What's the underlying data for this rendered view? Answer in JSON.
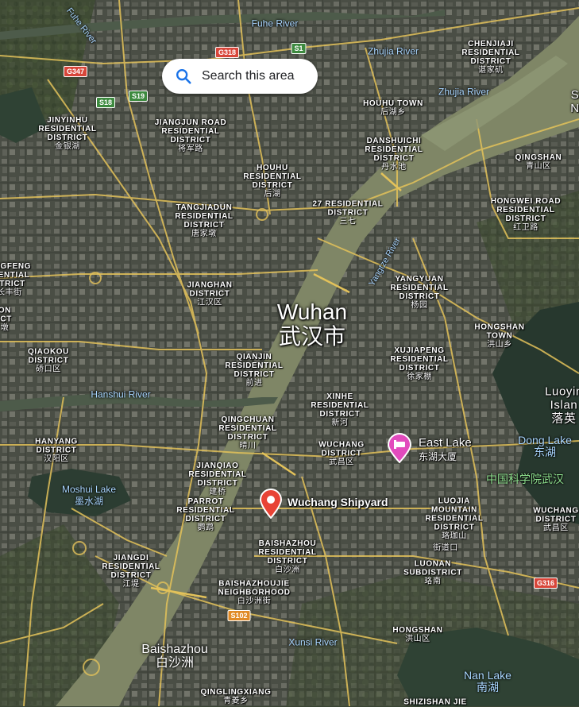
{
  "search": {
    "label": "Search this area",
    "icon": "search-icon"
  },
  "city": {
    "name_en": "Wuhan",
    "name_zh": "武汉市"
  },
  "colors": {
    "river": "#7f8666",
    "road": "#e3c25a",
    "search_icon": "#1a73e8",
    "marker_red": "#e84335",
    "marker_pink": "#e24bbd"
  },
  "markers": [
    {
      "id": "wuchang-shipyard",
      "label": "Wuchang Shipyard",
      "icon": "red-pin-icon"
    },
    {
      "id": "east-lake",
      "label": "East Lake",
      "label_zh": "东湖大厦",
      "icon": "hotel-pin-icon"
    }
  ],
  "shields": [
    "G347",
    "G318",
    "S1",
    "S18",
    "S19",
    "G316",
    "S102"
  ],
  "water": [
    {
      "id": "fuhe-river",
      "text": "Fuhe River"
    },
    {
      "id": "fuhe-river-diag",
      "text": "Fuhe River"
    },
    {
      "id": "zhujia-river-1",
      "text": "Zhujia River"
    },
    {
      "id": "zhujia-river-2",
      "text": "Zhujia River"
    },
    {
      "id": "yangtze-river",
      "text": "Yangtze River"
    },
    {
      "id": "hanshui-river",
      "text": "Hanshui River"
    },
    {
      "id": "moshui-lake",
      "text": "Moshui Lake",
      "zh": "墨水湖"
    },
    {
      "id": "dong-lake",
      "text": "Dong Lake",
      "zh": "东湖"
    },
    {
      "id": "xunsi-river",
      "text": "Xunsi River"
    },
    {
      "id": "nan-lake",
      "text": "Nan Lake",
      "zh": "南湖"
    },
    {
      "id": "baishazhou",
      "text": "Baishazhou",
      "zh": "白沙洲"
    }
  ],
  "labels": [
    {
      "id": "jinyinhu",
      "text": "JINYINHU\nRESIDENTIAL\nDISTRICT",
      "zh": "金银湖"
    },
    {
      "id": "jiangjun",
      "text": "JIANGJUN ROAD\nRESIDENTIAL\nDISTRICT",
      "zh": "将军路"
    },
    {
      "id": "houhu-town",
      "text": "HOUHU TOWN",
      "zh": "后湖乡"
    },
    {
      "id": "chenjiaji",
      "text": "CHENJIAJI\nRESIDENTIAL\nDISTRICT",
      "zh": "谌家矶"
    },
    {
      "id": "danshuichi",
      "text": "DANSHUICHI\nRESIDENTIAL\nDISTRICT",
      "zh": "丹水池"
    },
    {
      "id": "houhu-rd",
      "text": "HOUHU\nRESIDENTIAL\nDISTRICT",
      "zh": "后湖"
    },
    {
      "id": "qingshan",
      "text": "QINGSHAN",
      "zh": "青山区"
    },
    {
      "id": "tangjiadun",
      "text": "TANGJIADUN\nRESIDENTIAL\nDISTRICT",
      "zh": "唐家墩"
    },
    {
      "id": "27-rd",
      "text": "27 RESIDENTIAL\nDISTRICT",
      "zh": "三七"
    },
    {
      "id": "hongwei",
      "text": "HONGWEI ROAD\nRESIDENTIAL\nDISTRICT",
      "zh": "红卫路"
    },
    {
      "id": "angfeng",
      "text": "ANGFENG\nIDENTIAL\nSTRICT",
      "zh": "长丰街"
    },
    {
      "id": "jianghan",
      "text": "JIANGHAN\nDISTRICT",
      "zh": "江汉区"
    },
    {
      "id": "yangyuan",
      "text": "YANGYUAN\nRESIDENTIAL\nDISTRICT",
      "zh": "杨园"
    },
    {
      "id": "hongshan-town",
      "text": "HONGSHAN\nTOWN",
      "zh": "洪山乡"
    },
    {
      "id": "on-ict",
      "text": "ON\nICT",
      "zh": "墩"
    },
    {
      "id": "qiaokou",
      "text": "QIAOKOU\nDISTRICT",
      "zh": "硚口区"
    },
    {
      "id": "xujiapeng",
      "text": "XUJIAPENG\nRESIDENTIAL\nDISTRICT",
      "zh": "徐家棚"
    },
    {
      "id": "qianjin",
      "text": "QIANJIN\nRESIDENTIAL\nDISTRICT",
      "zh": "前进"
    },
    {
      "id": "xinhe",
      "text": "XINHE\nRESIDENTIAL\nDISTRICT",
      "zh": "新河"
    },
    {
      "id": "qingchuan",
      "text": "QINGCHUAN\nRESIDENTIAL\nDISTRICT",
      "zh": "晴川"
    },
    {
      "id": "hanyang",
      "text": "HANYANG\nDISTRICT",
      "zh": "汉阳区"
    },
    {
      "id": "wuchang",
      "text": "WUCHANG\nDISTRICT",
      "zh": "武昌区"
    },
    {
      "id": "luoyin",
      "text": "Luoyin\nIslan",
      "zh": "落英"
    },
    {
      "id": "jianqiao",
      "text": "JIANQIAO\nRESIDENTIAL\nDISTRICT",
      "zh": "建桥"
    },
    {
      "id": "parrot",
      "text": "PARROT\nRESIDENTIAL\nDISTRICT",
      "zh": "鹦鹉"
    },
    {
      "id": "luojia",
      "text": "LUOJIA\nMOUNTAIN\nRESIDENTIAL\nDISTRICT",
      "zh": "珞珈山"
    },
    {
      "id": "wuchang-2",
      "text": "WUCHANG\nDISTRICT",
      "zh": "武昌区"
    },
    {
      "id": "baishazhou-rd",
      "text": "BAISHAZHOU\nRESIDENTIAL\nDISTRICT",
      "zh": "白沙洲"
    },
    {
      "id": "jiedao",
      "text": "",
      "zh": "街道口"
    },
    {
      "id": "jiangdi",
      "text": "JIANGDI\nRESIDENTIAL\nDISTRICT",
      "zh": "江堤"
    },
    {
      "id": "luonan",
      "text": "LUONAN\nSUBDISTRICT",
      "zh": "珞南"
    },
    {
      "id": "baishazhoujie",
      "text": "BAISHAZHOUJIE\nNEIGHBORHOOD",
      "zh": "白沙洲街"
    },
    {
      "id": "hongshan",
      "text": "HONGSHAN",
      "zh": "洪山区"
    },
    {
      "id": "qinglingxiang",
      "text": "QINGLINGXIANG",
      "zh": "青菱乡"
    },
    {
      "id": "shizishan",
      "text": "SHIZISHAN JIE",
      "zh": ""
    },
    {
      "id": "edge-s",
      "text": "S\nN",
      "zh": ""
    }
  ],
  "green_label": {
    "text": "中国科学院武汉"
  }
}
